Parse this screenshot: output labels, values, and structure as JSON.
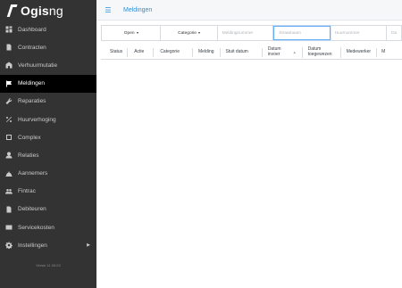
{
  "app": {
    "brand_bold": "Ogis",
    "brand_rest": "ng",
    "version": "Versie 11.05.03"
  },
  "sidebar": {
    "items": [
      {
        "label": "Dashboard",
        "icon": "dashboard-icon"
      },
      {
        "label": "Contracten",
        "icon": "contract-icon"
      },
      {
        "label": "Verhuurmutatie",
        "icon": "building-icon"
      },
      {
        "label": "Meldingen",
        "icon": "flag-icon",
        "active": true
      },
      {
        "label": "Reparaties",
        "icon": "wrench-icon"
      },
      {
        "label": "Huurverhoging",
        "icon": "percent-icon"
      },
      {
        "label": "Complex",
        "icon": "complex-icon"
      },
      {
        "label": "Relaties",
        "icon": "user-icon"
      },
      {
        "label": "Aannemers",
        "icon": "contractor-icon"
      },
      {
        "label": "Fintrac",
        "icon": "group-icon"
      },
      {
        "label": "Debiteuren",
        "icon": "document-icon"
      },
      {
        "label": "Servicekosten",
        "icon": "card-icon"
      },
      {
        "label": "Instellingen",
        "icon": "gear-icon",
        "has_submenu": true
      }
    ]
  },
  "header": {
    "title": "Meldingen"
  },
  "filters": {
    "status_value": "Open",
    "category_value": "Categorie",
    "melding_placeholder": "Meldingnummer",
    "straat_placeholder": "Straatnaam",
    "huur_placeholder": "Huurnummer",
    "da_placeholder": "Da"
  },
  "table": {
    "headers": [
      "Status",
      "Actie",
      "Categorie",
      "Melding",
      "Stuit datum",
      "Datum invoer",
      "Datum toegewezen",
      "Medewerker",
      "M"
    ],
    "sort_indicator": "▲"
  },
  "colors": {
    "sidebar_bg": "#333333",
    "active_bg": "#000000",
    "accent": "#2c8fd6"
  }
}
